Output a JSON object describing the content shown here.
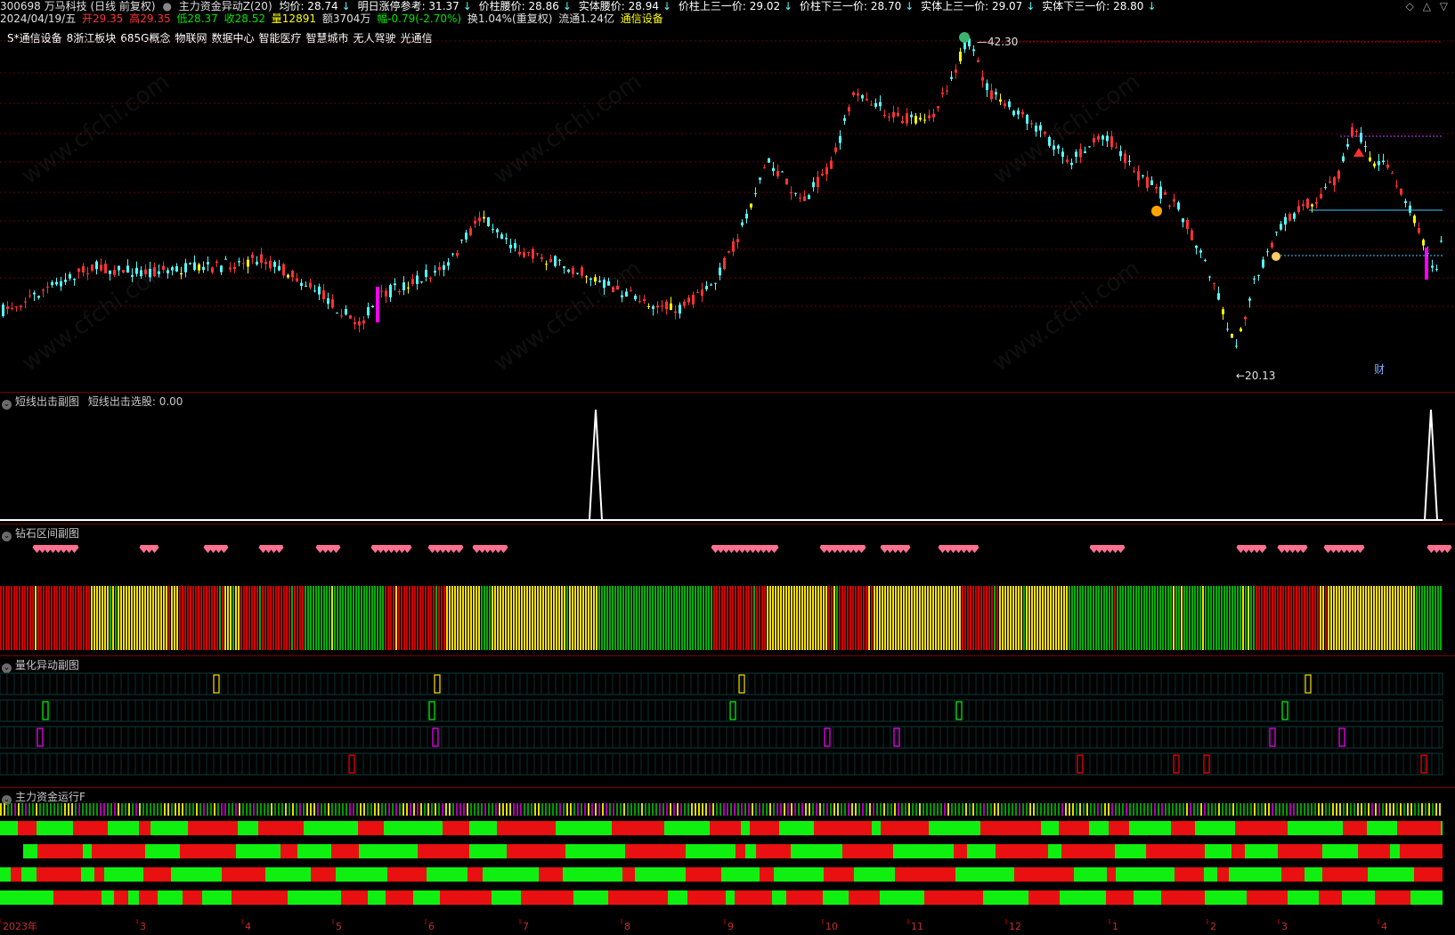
{
  "header": {
    "code_name": "300698 万马科技 (日线 前复权)",
    "indicator": "主力资金异动Z(20)",
    "avg_label": "均价: 28.74",
    "tomorrow_limit": "明日涨停参考: 31.37",
    "body_mid": "价柱腰价: 28.86",
    "solid_mid": "实体腰价: 28.94",
    "upper_third": "价柱上三一价: 29.02",
    "lower_third": "价柱下三一价: 28.70",
    "solid_upper": "实体上三一价: 29.07",
    "solid_lower": "实体下三一价: 28.80"
  },
  "quote": {
    "date": "2024/04/19/五",
    "open": "开29.35",
    "high": "高29.35",
    "low": "低28.37",
    "close": "收28.52",
    "volume": "量12891",
    "amount": "额3704万",
    "change": "幅-0.79(-2.70%)",
    "turnover": "换1.04%(重复权)",
    "float": "流通1.24亿",
    "sector": "通信设备"
  },
  "concepts": [
    "S*通信设备",
    "8浙江板块",
    "685G概念",
    "物联网",
    "数据中心",
    "智能医疗",
    "智慧城市",
    "无人驾驶",
    "光通信"
  ],
  "price_chart": {
    "high_label": "42.30",
    "low_label": "←20.13",
    "fin_badge": "财"
  },
  "panels": {
    "short_line": {
      "title": "短线出击副图",
      "value": "短线出击选股: 0.00"
    },
    "diamond": {
      "title": "钻石区间副图"
    },
    "quant": {
      "title": "量化异动副图"
    },
    "capital": {
      "title": "主力资金运行F"
    }
  },
  "time_axis": {
    "labels": [
      "2023年",
      "3",
      "4",
      "5",
      "6",
      "7",
      "8",
      "9",
      "10",
      "11",
      "12",
      "1",
      "2",
      "3",
      "4"
    ]
  },
  "colors": {
    "up": "#ff3232",
    "down": "#54fcfc",
    "yellow": "#ffff00",
    "magenta": "#ff00ff",
    "green": "#00c800",
    "bright_green": "#00ff00",
    "red_bar": "#e00000",
    "bg": "#000000",
    "grid": "#7a0000"
  }
}
